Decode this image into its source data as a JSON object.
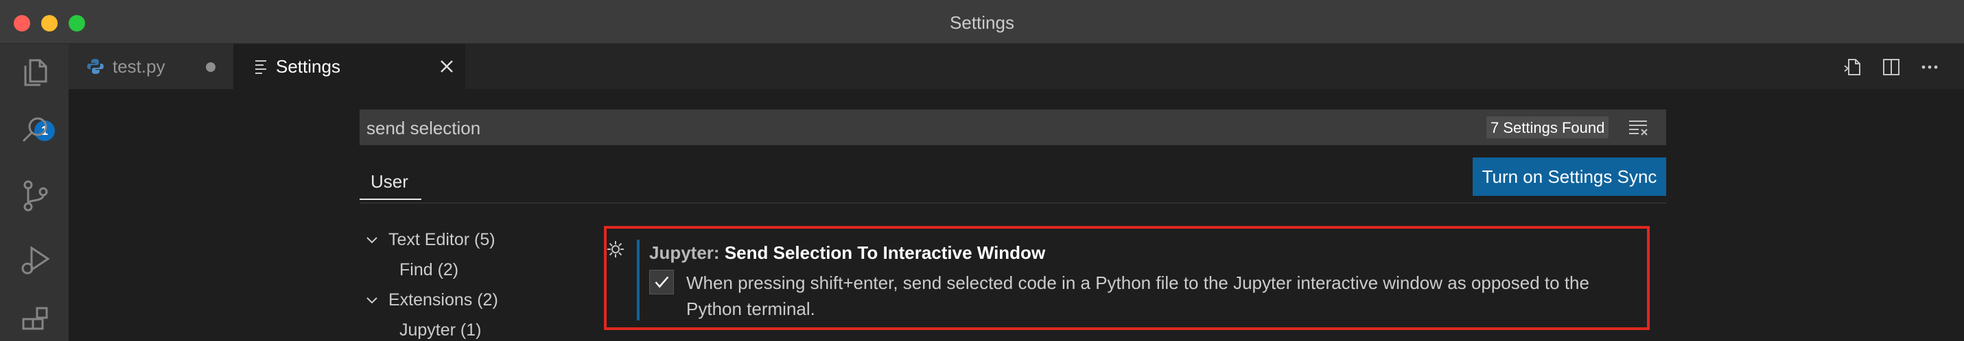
{
  "window": {
    "title": "Settings"
  },
  "activity": {
    "explorer_badge": "1"
  },
  "tabs": [
    {
      "label": "test.py",
      "modified": true
    },
    {
      "label": "Settings",
      "active": true
    }
  ],
  "search": {
    "value": "send selection",
    "results": "7 Settings Found"
  },
  "scope": {
    "tab": "User"
  },
  "sync": {
    "label": "Turn on Settings Sync"
  },
  "toc": [
    {
      "label": "Text Editor (5)",
      "expanded": true,
      "level": 0
    },
    {
      "label": "Find (2)",
      "level": 1
    },
    {
      "label": "Extensions (2)",
      "expanded": true,
      "level": 0
    },
    {
      "label": "Jupyter (1)",
      "level": 1
    }
  ],
  "setting": {
    "category": "Jupyter: ",
    "name": "Send Selection To Interactive Window",
    "checked": true,
    "description_line1": "When pressing shift+enter, send selected code in a Python file to the Jupyter interactive window as opposed to the",
    "description_line2": "Python terminal."
  },
  "colors": {
    "accent": "#0e639c",
    "highlight_box": "#e0281f",
    "badge": "#0e70c0"
  }
}
